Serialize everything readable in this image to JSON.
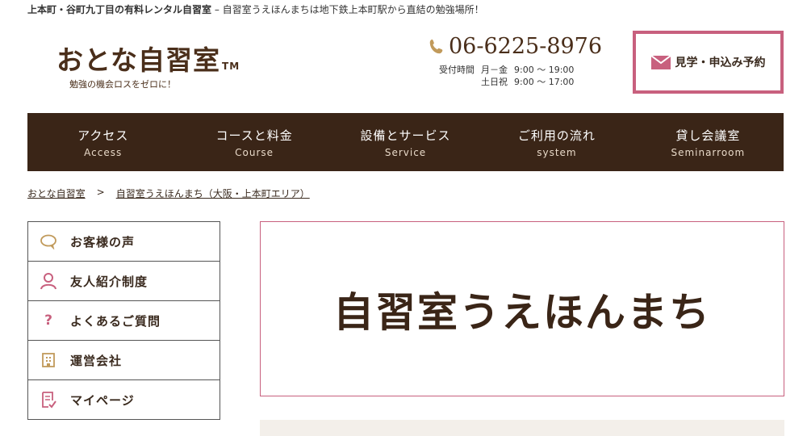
{
  "header": {
    "tagline_bold": "上本町・谷町九丁目の有料レンタル自習室",
    "tagline_rest": " – 自習室うえほんまちは地下鉄上本町駅から直結の勉強場所！",
    "logo_text": "おとな自習室",
    "logo_tm": "TM",
    "logo_sub": "勉強の機会ロスをゼロに！",
    "phone": "06-6225-8976",
    "hours_label": "受付時間",
    "hours_weekday_days": "月－金",
    "hours_weekday_time": "9:00 ～ 19:00",
    "hours_weekend_days": "土日祝",
    "hours_weekend_time": "9:00 ～ 17:00",
    "cta_label": "見学・申込み予約"
  },
  "nav": {
    "items": [
      {
        "jp": "アクセス",
        "en": "Access"
      },
      {
        "jp": "コースと料金",
        "en": "Course"
      },
      {
        "jp": "設備とサービス",
        "en": "Service"
      },
      {
        "jp": "ご利用の流れ",
        "en": "system"
      },
      {
        "jp": "貸し会議室",
        "en": "Seminarroom"
      }
    ]
  },
  "breadcrumb": {
    "home": "おとな自習室",
    "separator": ">",
    "current": "自習室うえほんまち（大阪・上本町エリア）"
  },
  "sidebar": {
    "items": [
      {
        "label": "お客様の声",
        "icon": "speech-bubble-icon"
      },
      {
        "label": "友人紹介制度",
        "icon": "person-icon"
      },
      {
        "label": "よくあるご質問",
        "icon": "question-icon"
      },
      {
        "label": "運営会社",
        "icon": "building-icon"
      },
      {
        "label": "マイページ",
        "icon": "document-check-icon"
      }
    ]
  },
  "main": {
    "page_title": "自習室うえほんまち"
  },
  "colors": {
    "brown_dark": "#3a2517",
    "brown_text": "#4a2e1a",
    "accent_pink": "#c8607e",
    "accent_gold": "#c19a5b"
  }
}
